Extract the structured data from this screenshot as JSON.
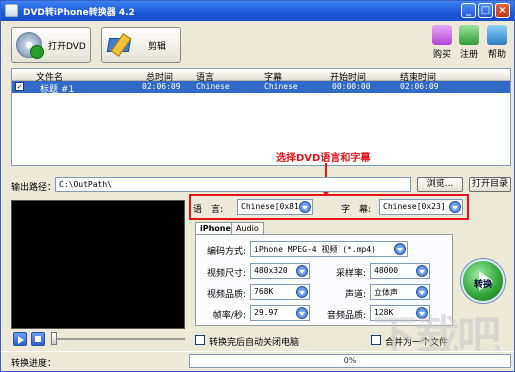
{
  "window": {
    "title": "DVD转iPhone转换器 4.2"
  },
  "toolbar": {
    "open_dvd": "打开DVD",
    "edit": "剪辑",
    "buy": "购买",
    "register": "注册",
    "help": "帮助"
  },
  "list": {
    "headers": [
      "文件名",
      "总时间",
      "语言",
      "字幕",
      "开始时间",
      "结束时间"
    ],
    "rows": [
      {
        "name": "标题 #1",
        "total": "02:06:09",
        "language": "Chinese",
        "subtitle": "Chinese",
        "start": "00:00:00",
        "end": "02:06:09"
      }
    ]
  },
  "output": {
    "label": "输出路径：",
    "path": "C:\\OutPath\\",
    "browse": "浏览...",
    "open_dir": "打开目录"
  },
  "annotation": "选择DVD语言和字幕",
  "lang": {
    "label": "语　言:",
    "value": "Chinese[0x81]"
  },
  "sub": {
    "label": "字　幕:",
    "value": "Chinese[0x23]"
  },
  "tabs": [
    "iPhone",
    "Audio"
  ],
  "settings": {
    "codec_lbl": "编码方式:",
    "codec": "iPhone MPEG-4 视频 (*.mp4)",
    "size_lbl": "视频尺寸:",
    "size": "480x320",
    "vq_lbl": "视频品质:",
    "vq": "768K",
    "fps_lbl": "帧率/秒:",
    "fps": "29.97",
    "sr_lbl": "采样率:",
    "sr": "48000",
    "ch_lbl": "声道:",
    "ch": "立体声",
    "aq_lbl": "音频品质:",
    "aq": "128K"
  },
  "options": {
    "shutdown": "转换完后自动关闭电脑",
    "merge": "合并为一个文件"
  },
  "convert": "转换",
  "status": {
    "label": "转换进度：",
    "progress": "0%"
  },
  "colors": {
    "accent": "#316ac5",
    "annotation": "#e5141b"
  }
}
